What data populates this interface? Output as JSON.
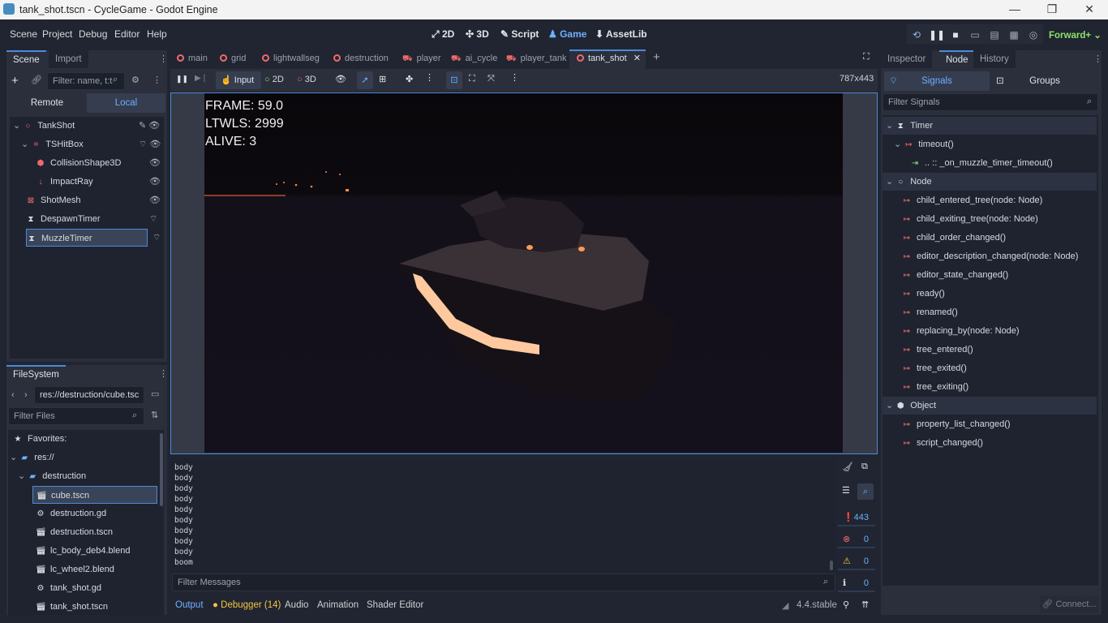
{
  "window": {
    "title": "tank_shot.tscn - CycleGame - Godot Engine",
    "min": "—",
    "max": "❐",
    "close": "✕"
  },
  "menu": [
    "Scene",
    "Project",
    "Debug",
    "Editor",
    "Help"
  ],
  "main_screens": [
    "2D",
    "3D",
    "Script",
    "Game",
    "AssetLib"
  ],
  "renderer": "Forward+",
  "scene_dock": {
    "tabs": [
      "Scene",
      "Import"
    ],
    "filter_placeholder": "Filter: name, t:t",
    "remote": "Remote",
    "local": "Local",
    "tree": [
      "TankShot",
      "TSHitBox",
      "CollisionShape3D",
      "ImpactRay",
      "ShotMesh",
      "DespawnTimer",
      "MuzzleTimer"
    ]
  },
  "filesystem": {
    "tab": "FileSystem",
    "path": "res://destruction/cube.tsc",
    "filter_placeholder": "Filter Files",
    "items": [
      "Favorites:",
      "res://",
      "destruction",
      "cube.tscn",
      "destruction.gd",
      "destruction.tscn",
      "lc_body_deb4.blend",
      "lc_wheel2.blend",
      "tank_shot.gd",
      "tank_shot.tscn"
    ]
  },
  "editor_tabs": [
    "main",
    "grid",
    "lightwallseg",
    "destruction",
    "player",
    "ai_cycle",
    "player_tank",
    "tank_shot"
  ],
  "game_toolbar": {
    "input": "Input",
    "mode2d": "2D",
    "mode3d": "3D",
    "size": "787x443"
  },
  "hud": {
    "frame": "FRAME: 59.0",
    "ltwls": "LTWLS: 2999",
    "alive": "ALIVE: 3"
  },
  "console": {
    "lines": [
      "body",
      "body",
      "body",
      "body",
      "body",
      "body",
      "body",
      "body",
      "body",
      "boom"
    ],
    "filter_placeholder": "Filter Messages",
    "counts": {
      "messages": "443",
      "errors": "0",
      "warnings": "0",
      "info": "0"
    }
  },
  "bottom_tabs": {
    "output": "Output",
    "debugger": "Debugger (14)",
    "audio": "Audio",
    "animation": "Animation",
    "shader": "Shader Editor",
    "version": "4.4.stable"
  },
  "inspector": {
    "tabs": [
      "Inspector",
      "Node",
      "History"
    ],
    "signals": "Signals",
    "groups": "Groups",
    "filter_placeholder": "Filter Signals",
    "timer_section": "Timer",
    "timeout": "timeout()",
    "connection": ".. :: _on_muzzle_timer_timeout()",
    "node_section": "Node",
    "node_signals": [
      "child_entered_tree(node: Node)",
      "child_exiting_tree(node: Node)",
      "child_order_changed()",
      "editor_description_changed(node: Node)",
      "editor_state_changed()",
      "ready()",
      "renamed()",
      "replacing_by(node: Node)",
      "tree_entered()",
      "tree_exited()",
      "tree_exiting()"
    ],
    "object_section": "Object",
    "object_signals": [
      "property_list_changed()",
      "script_changed()"
    ],
    "connect": "Connect..."
  }
}
